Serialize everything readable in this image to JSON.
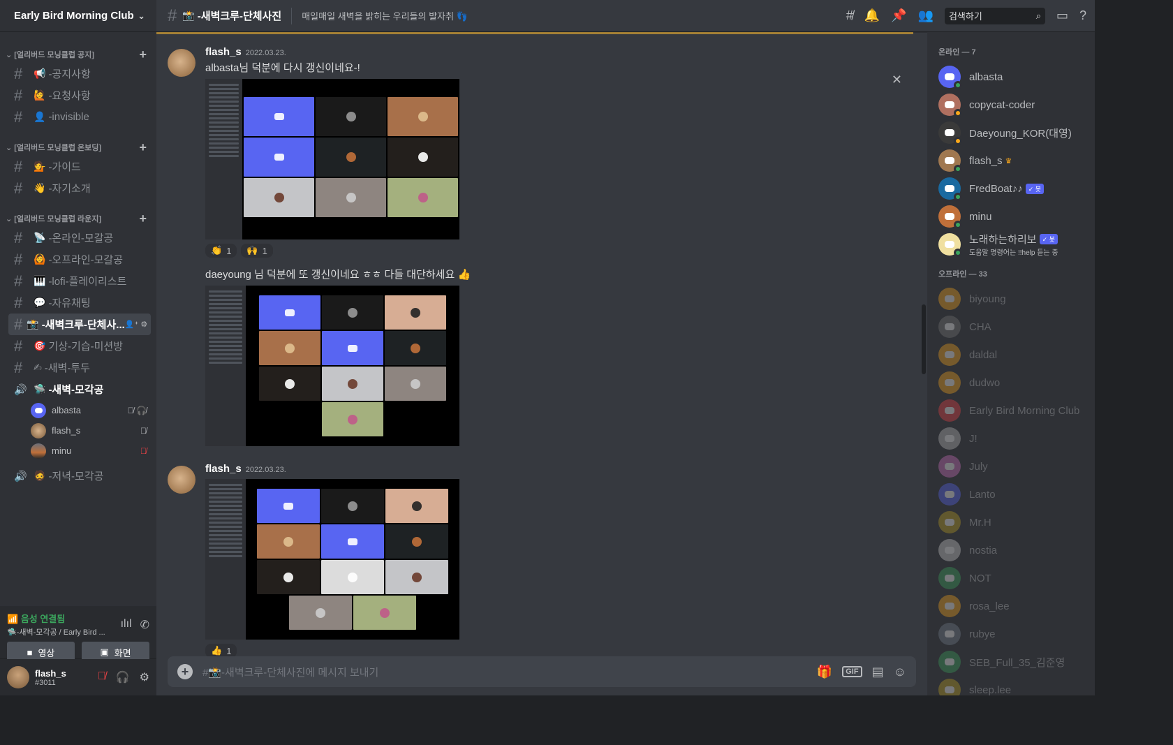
{
  "server": {
    "name": "Early Bird Morning Club"
  },
  "categories": [
    {
      "label": "[얼리버드 모닝클럽 공지]",
      "channels": [
        {
          "name": "-공지사항",
          "emoji": "📢"
        },
        {
          "name": "-요청사항",
          "emoji": "🙋"
        },
        {
          "name": "-invisible",
          "emoji": "👤"
        }
      ]
    },
    {
      "label": "[얼리버드 모닝클럽 온보딩]",
      "channels": [
        {
          "name": "-가이드",
          "emoji": "💁"
        },
        {
          "name": "-자기소개",
          "emoji": "👋"
        }
      ]
    },
    {
      "label": "[얼리버드 모닝클럽 라운지]",
      "channels": [
        {
          "name": "-온라인-모갈공",
          "emoji": "📡"
        },
        {
          "name": "-오프라인-모갈공",
          "emoji": "🙆"
        },
        {
          "name": "-lofi-플레이리스트",
          "emoji": "🎹"
        },
        {
          "name": "-자유채팅",
          "emoji": "💬"
        },
        {
          "name": "-새벽크루-단체사...",
          "emoji": "📸"
        },
        {
          "name": "기상-기습-미션방",
          "emoji": "🎯"
        },
        {
          "name": "-새벽-투두",
          "emoji": "✍"
        },
        {
          "name": "-새벽-모각공",
          "emoji": "🛸"
        },
        {
          "name": "-저녁-모각공",
          "emoji": "🧔"
        }
      ]
    }
  ],
  "voice_users": [
    {
      "name": "albasta",
      "color": "#5865f2"
    },
    {
      "name": "flash_s",
      "color": "#a07850"
    },
    {
      "name": "minu",
      "color": "#c0703a"
    }
  ],
  "voice_panel": {
    "status": "음성 연결됨",
    "sub": "🛸-새벽-모각공 / Early Bird ...",
    "video": "영상",
    "screen": "화면"
  },
  "user": {
    "name": "flash_s",
    "tag": "#3011"
  },
  "channel": {
    "emoji": "📸",
    "title": "-새벽크루-단체사진",
    "topic": "매일매일 새벽을 밝히는 우리들의 발자취 👣"
  },
  "search": {
    "placeholder": "검색하기"
  },
  "messages": [
    {
      "author": "flash_s",
      "time": "2022.03.23.",
      "text": "albasta님 덕분에 다시 갱신이네요-!",
      "reactions": [
        {
          "emoji": "👏",
          "count": "1"
        },
        {
          "emoji": "🙌",
          "count": "1"
        }
      ]
    },
    {
      "text": "daeyoung 님 덕분에 또 갱신이네요 ㅎㅎ 다들 대단하세요 👍"
    },
    {
      "author": "flash_s",
      "time": "2022.03.23.",
      "reactions": [
        {
          "emoji": "👍",
          "count": "1"
        }
      ]
    }
  ],
  "composer": {
    "placeholder": "#📸-새벽크루-단체사진에 메시지 보내기",
    "gif": "GIF"
  },
  "members": {
    "online_label": "온라인 — 7",
    "online": [
      {
        "name": "albasta",
        "color": "#5865f2"
      },
      {
        "name": "copycat-coder",
        "color": "#b07060"
      },
      {
        "name": "Daeyoung_KOR(대영)",
        "color": "#3a3a3a"
      },
      {
        "name": "flash_s",
        "color": "#a07850"
      },
      {
        "name": "FredBoat♪♪",
        "color": "#1a6aa0",
        "bot": "✓ 봇"
      },
      {
        "name": "minu",
        "color": "#c0703a"
      },
      {
        "name": "노래하는하리보",
        "color": "#f0e0a0",
        "bot": "✓ 봇",
        "sub": "도움말 명령어는 !!help 듣는 중"
      }
    ],
    "offline_label": "오프라인 — 33",
    "offline": [
      {
        "name": "biyoung",
        "color": "#faa81a"
      },
      {
        "name": "CHA",
        "color": "#777777"
      },
      {
        "name": "daldal",
        "color": "#faa81a"
      },
      {
        "name": "dudwo",
        "color": "#faa81a"
      },
      {
        "name": "Early Bird Morning Club",
        "color": "#ed4245"
      },
      {
        "name": "J!",
        "color": "#bbbbbb"
      },
      {
        "name": "July",
        "color": "#d070c0"
      },
      {
        "name": "Lanto",
        "color": "#5865f2"
      },
      {
        "name": "Mr.H",
        "color": "#c0a020"
      },
      {
        "name": "nostia",
        "color": "#cccccc"
      },
      {
        "name": "NOT",
        "color": "#3ba55d"
      },
      {
        "name": "rosa_lee",
        "color": "#faa81a"
      },
      {
        "name": "rubye",
        "color": "#747f8d"
      },
      {
        "name": "SEB_Full_35_김준영",
        "color": "#3ba55d"
      },
      {
        "name": "sleep.lee",
        "color": "#c0a020"
      }
    ]
  }
}
